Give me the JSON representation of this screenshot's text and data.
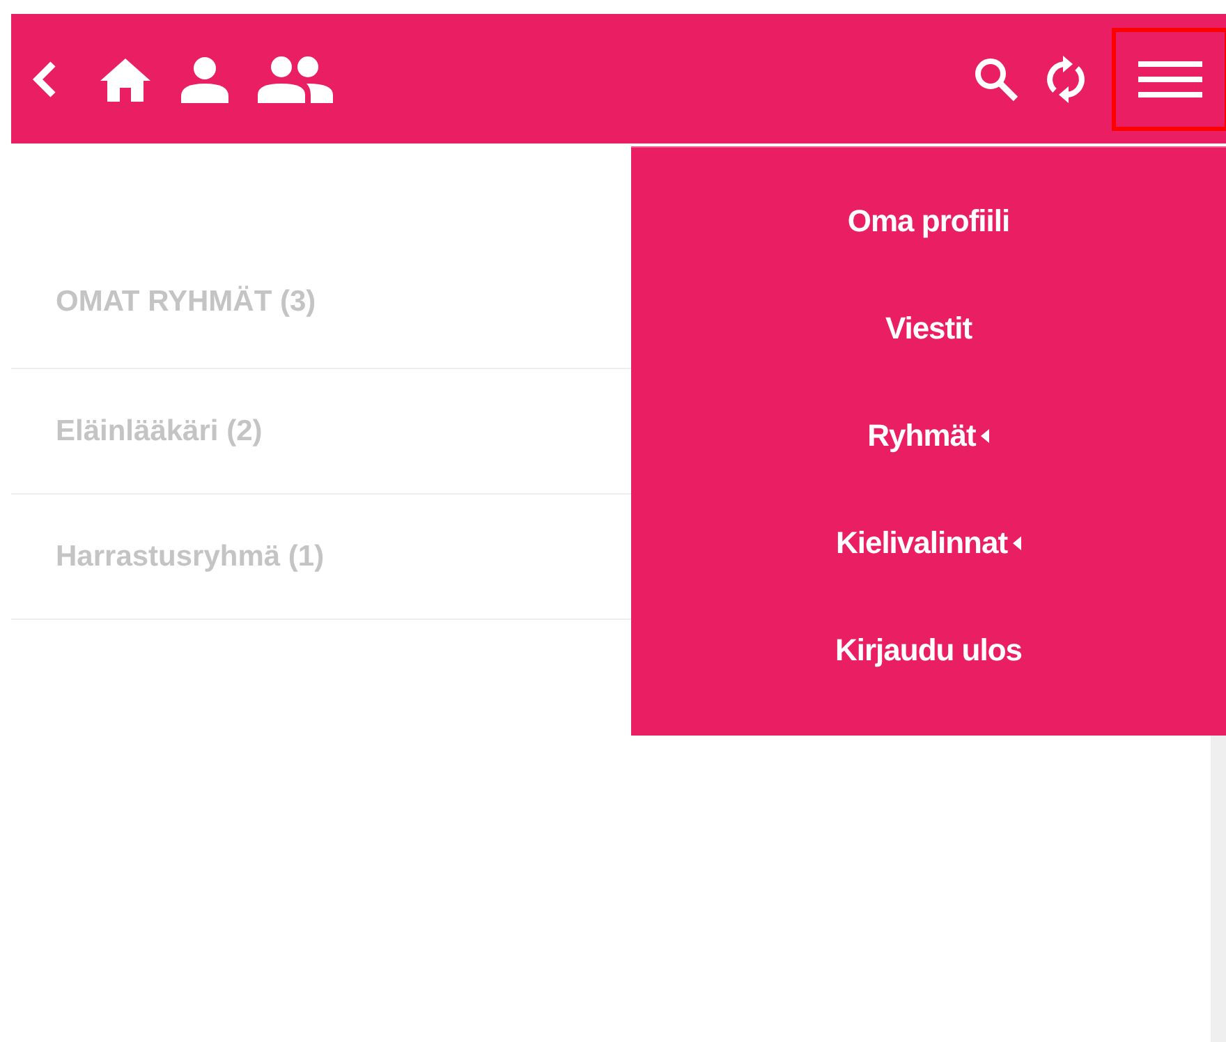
{
  "header": {
    "menu_button": {
      "focused": true
    }
  },
  "groups": {
    "title": "OMAT RYHMÄT (3)",
    "items": [
      {
        "label": "Eläinlääkäri (2)"
      },
      {
        "label": "Harrastusryhmä (1)"
      }
    ]
  },
  "menu": {
    "items": [
      {
        "label": "Oma profiili",
        "submenu": false
      },
      {
        "label": "Viestit",
        "submenu": false
      },
      {
        "label": "Ryhmät",
        "submenu": true
      },
      {
        "label": "Kielivalinnat",
        "submenu": true
      },
      {
        "label": "Kirjaudu ulos",
        "submenu": false
      }
    ]
  }
}
